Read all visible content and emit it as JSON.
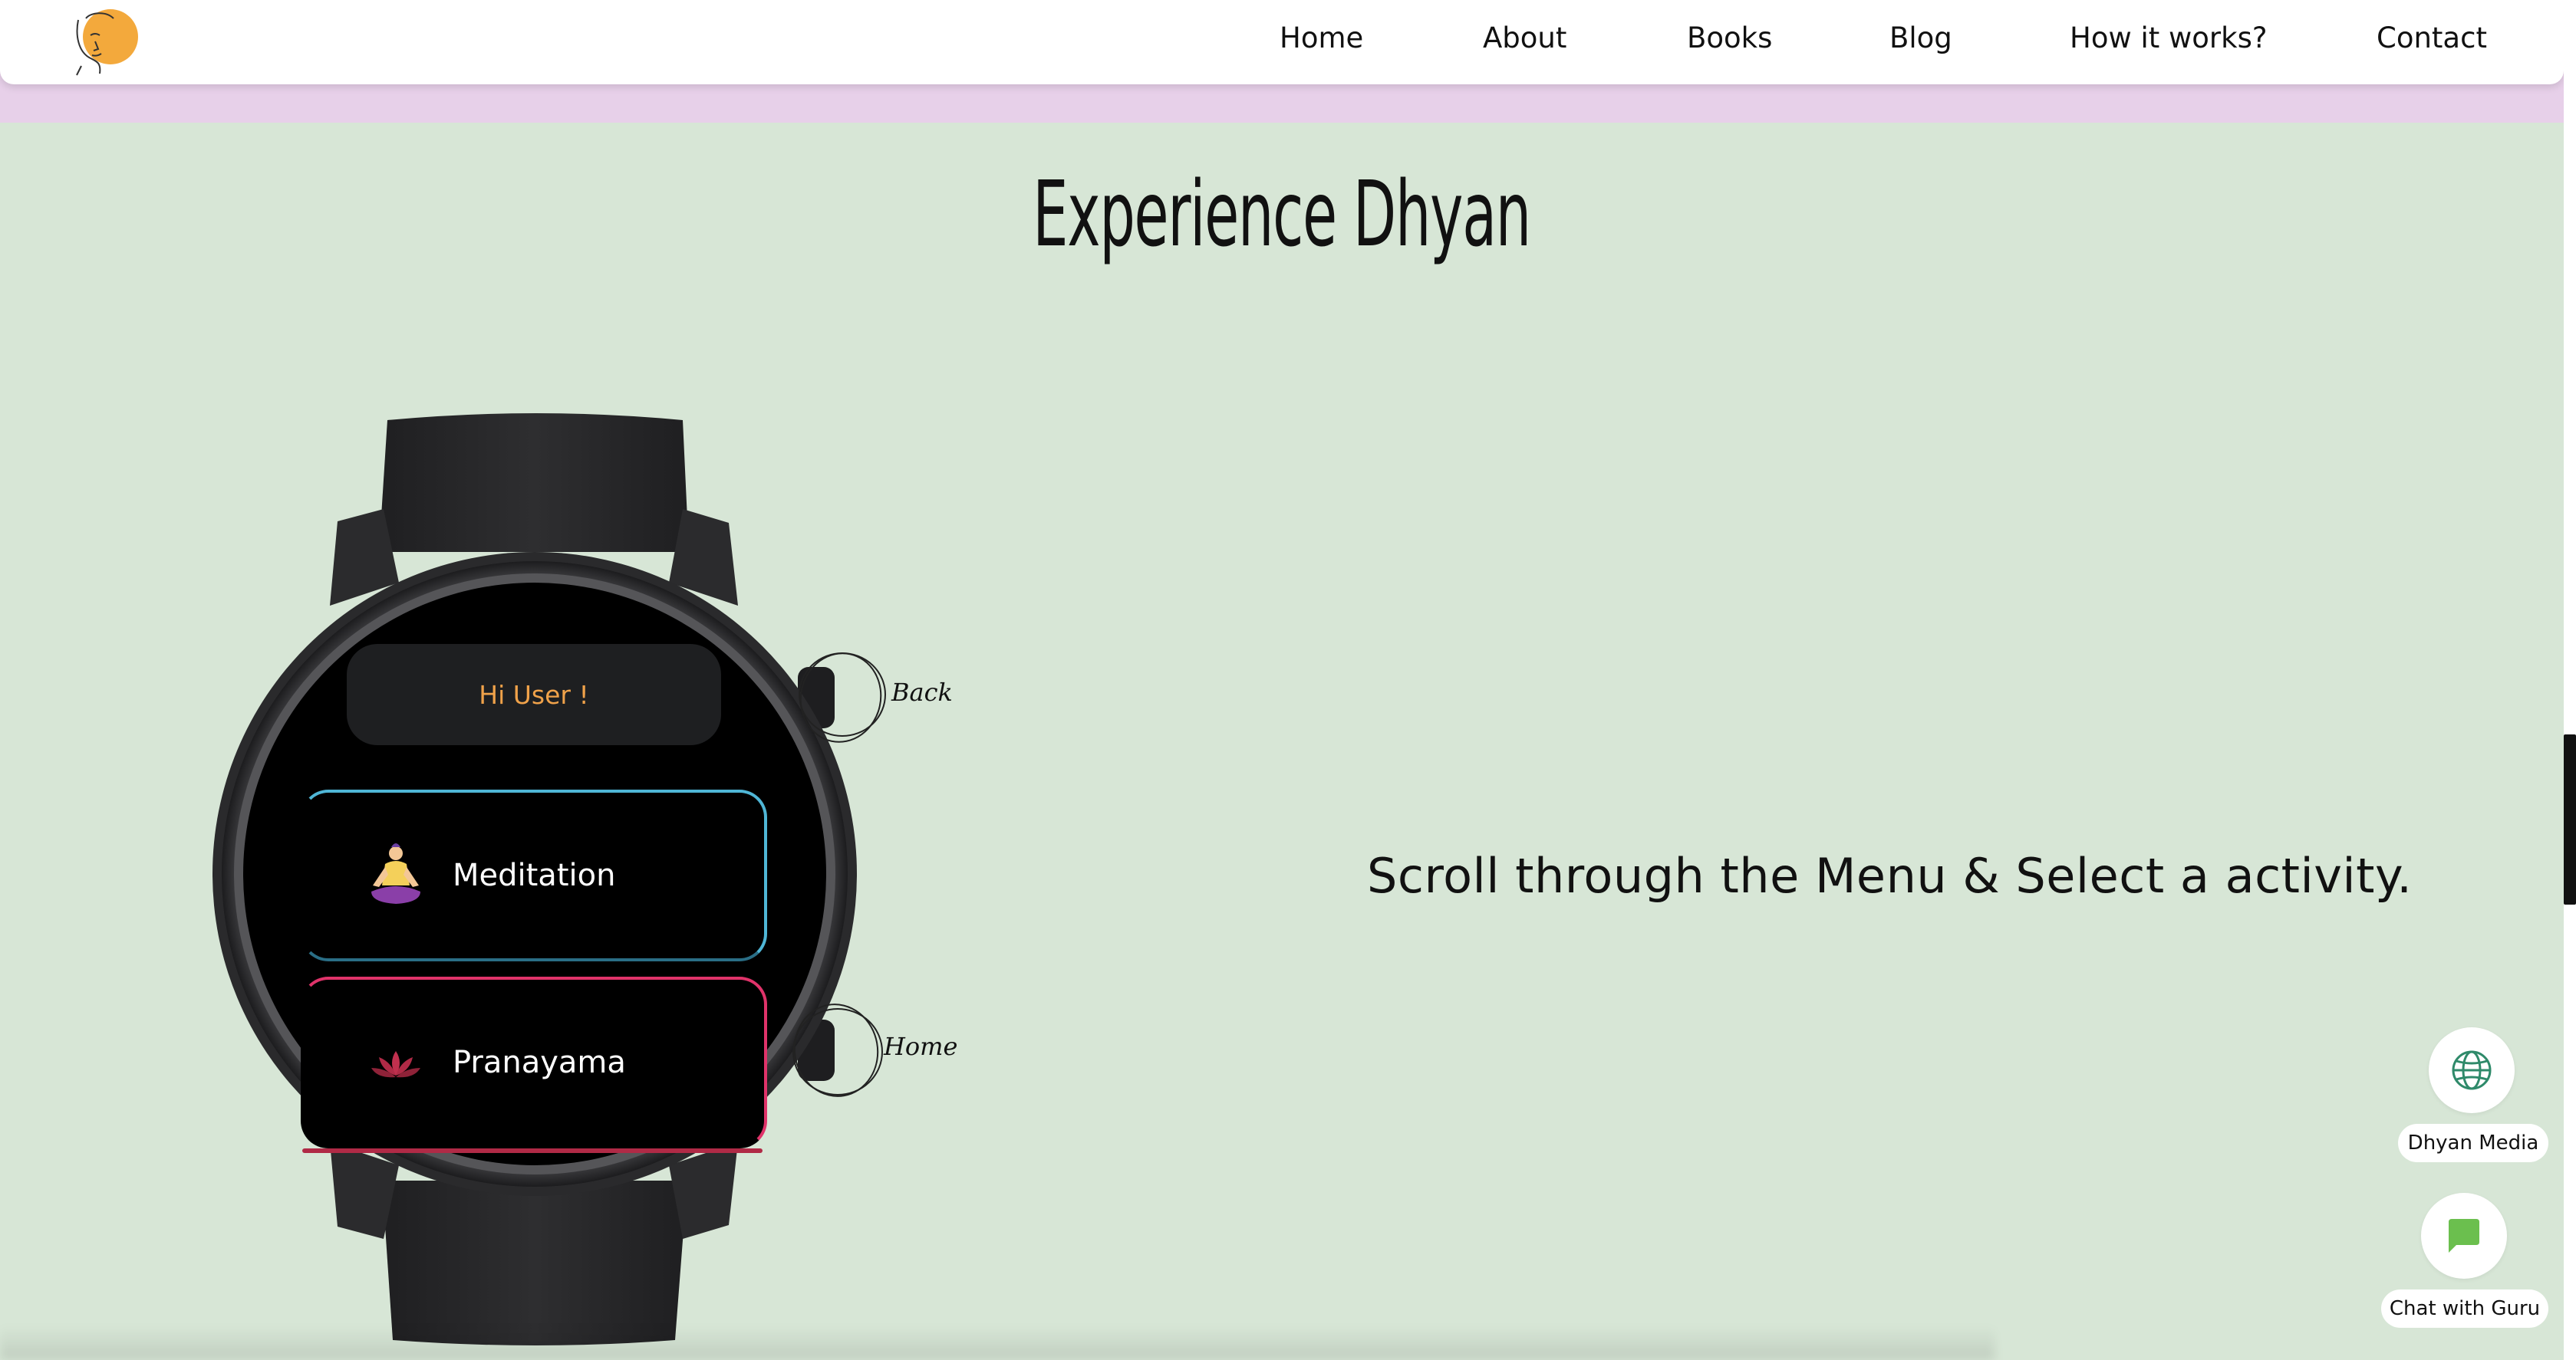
{
  "nav": {
    "logo_name": "dhyan-logo",
    "links": [
      {
        "label": "Home"
      },
      {
        "label": "About"
      },
      {
        "label": "Books"
      },
      {
        "label": "Blog"
      },
      {
        "label": "How it works?"
      },
      {
        "label": "Contact"
      }
    ]
  },
  "section": {
    "title": "Experience Dhyan",
    "tagline": "Scroll through the Menu & Select a activity."
  },
  "watch": {
    "greeting": "Hi User !",
    "back_label": "Back",
    "home_label": "Home",
    "menu": [
      {
        "label": "Meditation",
        "icon": "meditation-icon",
        "accent": "#4fb6d6"
      },
      {
        "label": "Pranayama",
        "icon": "lotus-icon",
        "accent": "#e0336a"
      }
    ]
  },
  "floating": {
    "media_label": "Dhyan Media",
    "media_icon": "globe-icon",
    "chat_label": "Chat with Guru",
    "chat_icon": "chat-icon"
  },
  "colors": {
    "background": "#d7e6d6",
    "strip": "#e7d0e9",
    "logo_accent": "#f3a93c",
    "greeting_text": "#f0a24a",
    "chat_icon": "#6bbf4e",
    "globe_icon": "#2f8a6a"
  }
}
